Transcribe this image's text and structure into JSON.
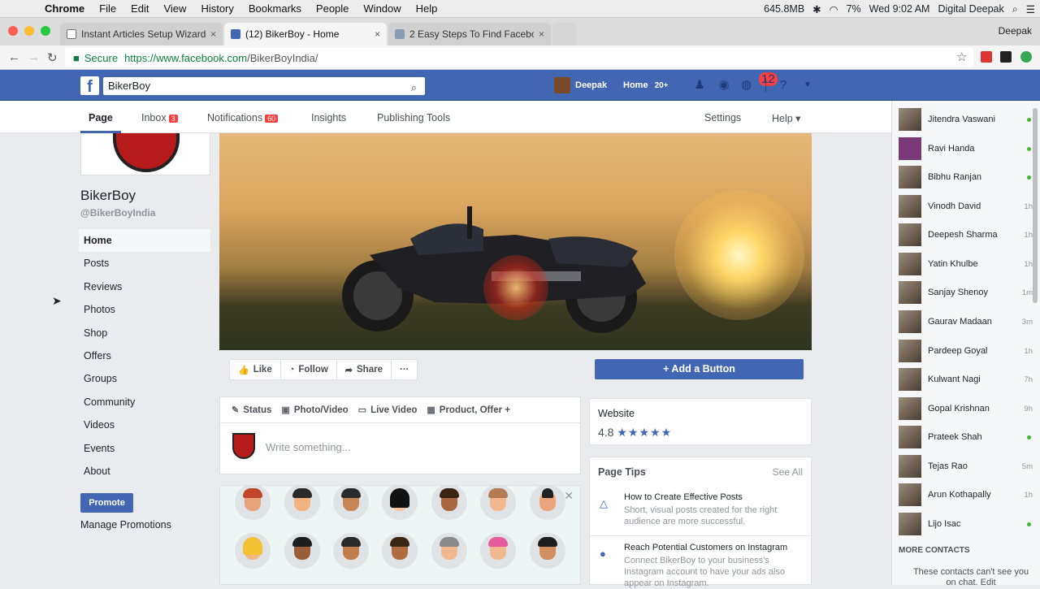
{
  "mac_menu": {
    "app": "Chrome",
    "items": [
      "File",
      "Edit",
      "View",
      "History",
      "Bookmarks",
      "People",
      "Window",
      "Help"
    ],
    "status": {
      "memory": "645.8MB",
      "battery": "7%",
      "datetime": "Wed 9:02 AM",
      "user": "Digital Deepak"
    }
  },
  "tabs": [
    {
      "title": "Instant Articles Setup Wizard",
      "close": "×"
    },
    {
      "title": "(12) BikerBoy - Home",
      "close": "×"
    },
    {
      "title": "2 Easy Steps To Find Faceboo",
      "close": "×"
    }
  ],
  "profile_name": "Deepak",
  "address": {
    "secure": "Secure",
    "proto": "https://www.facebook.com",
    "path": "/BikerBoyIndia/"
  },
  "fb": {
    "search_value": "BikerBoy",
    "user": "Deepak",
    "home": "Home",
    "home_count": "20+",
    "notif_count": "12"
  },
  "page_nav": {
    "page": "Page",
    "inbox": "Inbox",
    "inbox_count": "3",
    "notifications": "Notifications",
    "notif_count": "60",
    "insights": "Insights",
    "publishing": "Publishing Tools",
    "settings": "Settings",
    "help": "Help ▾"
  },
  "page": {
    "name": "BikerBoy",
    "handle": "@BikerBoyIndia"
  },
  "left_nav": [
    "Home",
    "Posts",
    "Reviews",
    "Photos",
    "Shop",
    "Offers",
    "Groups",
    "Community",
    "Videos",
    "Events",
    "About"
  ],
  "promote": {
    "button": "Promote",
    "manage": "Manage Promotions"
  },
  "actions": {
    "like": "Like",
    "follow": "Follow",
    "share": "Share",
    "more": "···",
    "add_button": "+ Add a Button"
  },
  "composer": {
    "tabs": [
      {
        "icon": "✎",
        "label": "Status"
      },
      {
        "icon": "▣",
        "label": "Photo/Video"
      },
      {
        "icon": "▭",
        "label": "Live Video"
      },
      {
        "icon": "▦",
        "label": "Product, Offer +"
      }
    ],
    "placeholder": "Write something..."
  },
  "website": {
    "title": "Website",
    "rating": "4.8",
    "stars": "★★★★★"
  },
  "tips": {
    "header": "Page Tips",
    "see_all": "See All",
    "items": [
      {
        "title": "How to Create Effective Posts",
        "desc": "Short, visual posts created for the right audience are more successful."
      },
      {
        "title": "Reach Potential Customers on Instagram",
        "desc": "Connect BikerBoy to your business's Instagram account to have your ads also appear on Instagram."
      }
    ]
  },
  "contacts": [
    {
      "name": "Jitendra Vaswani",
      "status": "online"
    },
    {
      "name": "Ravi Handa",
      "status": "online"
    },
    {
      "name": "Bibhu Ranjan",
      "status": "online"
    },
    {
      "name": "Vinodh David",
      "status": "1h"
    },
    {
      "name": "Deepesh Sharma",
      "status": "1h"
    },
    {
      "name": "Yatin Khulbe",
      "status": "1h"
    },
    {
      "name": "Sanjay Shenoy",
      "status": "1m"
    },
    {
      "name": "Gaurav Madaan",
      "status": "3m"
    },
    {
      "name": "Pardeep Goyal",
      "status": "1h"
    },
    {
      "name": "Kulwant Nagi",
      "status": "7h"
    },
    {
      "name": "Gopal Krishnan",
      "status": "9h"
    },
    {
      "name": "Prateek Shah",
      "status": "online"
    },
    {
      "name": "Tejas Rao",
      "status": "5m"
    },
    {
      "name": "Arun Kothapally",
      "status": "1h"
    },
    {
      "name": "Lijo Isac",
      "status": "online"
    }
  ],
  "more_contacts": "MORE CONTACTS",
  "chat_notice": "These contacts can't see you on chat. Edit"
}
